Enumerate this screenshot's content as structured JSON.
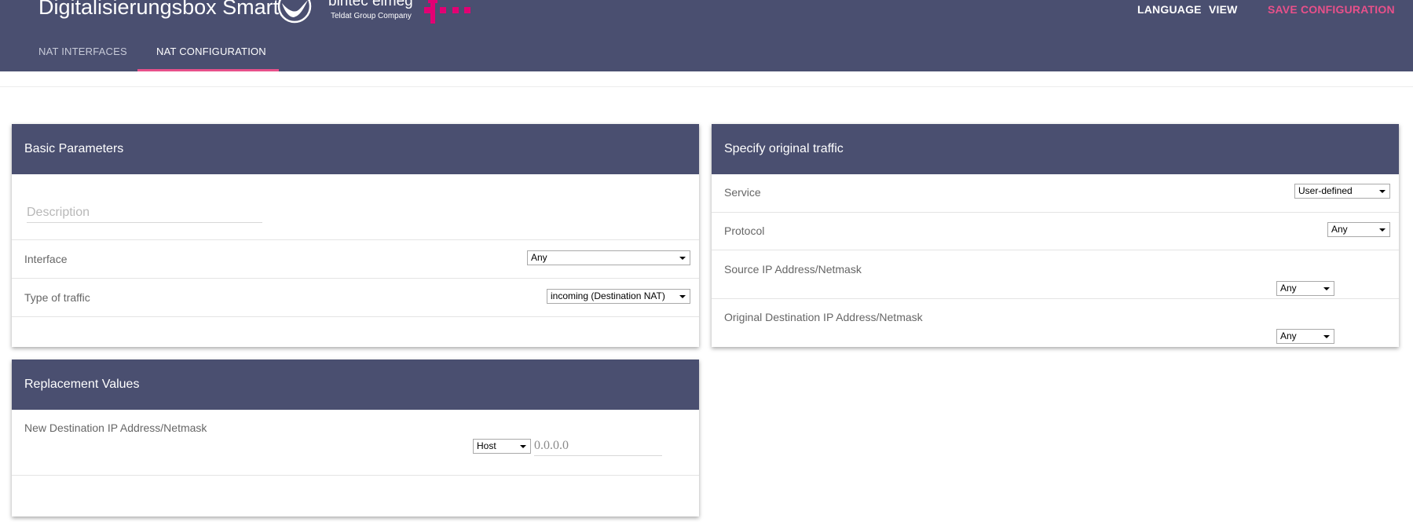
{
  "header": {
    "brand_title": "Digitalisierungsbox Smart",
    "logo_text": "bintec elmeg",
    "logo_subtext": "Teldat Group Company",
    "telekom_icon": "telekom-t-icon",
    "nav": {
      "language": "LANGUAGE",
      "view": "VIEW",
      "save_configuration": "SAVE CONFIGURATION"
    },
    "tabs": [
      {
        "label": "NAT INTERFACES",
        "active": false
      },
      {
        "label": "NAT CONFIGURATION",
        "active": true
      }
    ]
  },
  "colors": {
    "header_bg": "#4a4f70",
    "accent": "#e8508a",
    "telekom_magenta": "#e20074"
  },
  "basic_parameters": {
    "title": "Basic Parameters",
    "description_placeholder": "Description",
    "interface_label": "Interface",
    "interface_value": "Any",
    "traffic_type_label": "Type of traffic",
    "traffic_type_value": "incoming (Destination NAT)"
  },
  "replacement_values": {
    "title": "Replacement Values",
    "new_destination_label": "New Destination IP Address/Netmask",
    "new_destination_type": "Host",
    "new_destination_ip_placeholder": "0.0.0.0"
  },
  "original_traffic": {
    "title": "Specify original traffic",
    "service_label": "Service",
    "service_value": "User-defined",
    "protocol_label": "Protocol",
    "protocol_value": "Any",
    "source_label": "Source IP Address/Netmask",
    "source_value": "Any",
    "orig_destination_label": "Original Destination IP Address/Netmask",
    "orig_destination_value": "Any"
  }
}
